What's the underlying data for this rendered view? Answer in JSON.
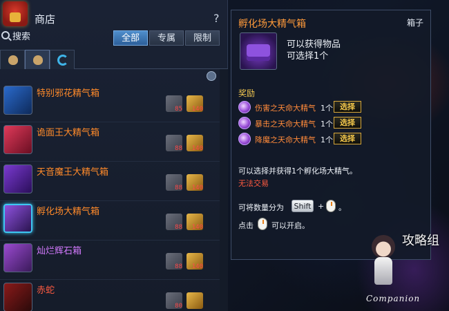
{
  "shop": {
    "title": "商店",
    "help": "?",
    "search_placeholder": "搜索",
    "filter_tabs": [
      "全部",
      "专属",
      "限制"
    ],
    "items": [
      {
        "name": "特别邪花精气箱",
        "color": "orange",
        "cost1": "85",
        "cost2": "140"
      },
      {
        "name": "诡面王大精气箱",
        "color": "orange",
        "cost1": "88",
        "cost2": "140"
      },
      {
        "name": "天音魔王大精气箱",
        "color": "orange",
        "cost1": "88",
        "cost2": "140"
      },
      {
        "name": "孵化场大精气箱",
        "color": "orange",
        "cost1": "88",
        "cost2": "140",
        "selected": true
      },
      {
        "name": "灿烂辉石箱",
        "color": "purple",
        "cost1": "88",
        "cost2": "140"
      },
      {
        "name": "赤蛇",
        "color": "red",
        "cost1": "80",
        "cost2": ""
      }
    ]
  },
  "tooltip": {
    "title": "孵化场大精气箱",
    "type": "箱子",
    "line1": "可以获得物品",
    "line2": "可选择1个",
    "reward_label": "奖励",
    "rewards": [
      {
        "name": "伤害之天命大精气",
        "qty": "1个",
        "button": "选择"
      },
      {
        "name": "暴击之天命大精气",
        "qty": "1个",
        "button": "选择"
      },
      {
        "name": "降魔之天命大精气",
        "qty": "1个",
        "button": "选择"
      }
    ],
    "description": "可以选择并获得1个孵化场大精气。",
    "warning": "无法交易",
    "split_prefix": "可将数量分为",
    "shift_key": "Shift",
    "plus": "+",
    "split_suffix": "。",
    "open_prefix": "点击",
    "open_suffix": "可以开启。"
  },
  "watermark": {
    "brand": "Companion",
    "chars": "攻略组"
  },
  "colors": {
    "accent_blue": "#4f8ecc",
    "item_orange": "#ff8a2a",
    "item_purple": "#d47aff",
    "warn_red": "#ff5a40",
    "gold": "#f0c650"
  }
}
